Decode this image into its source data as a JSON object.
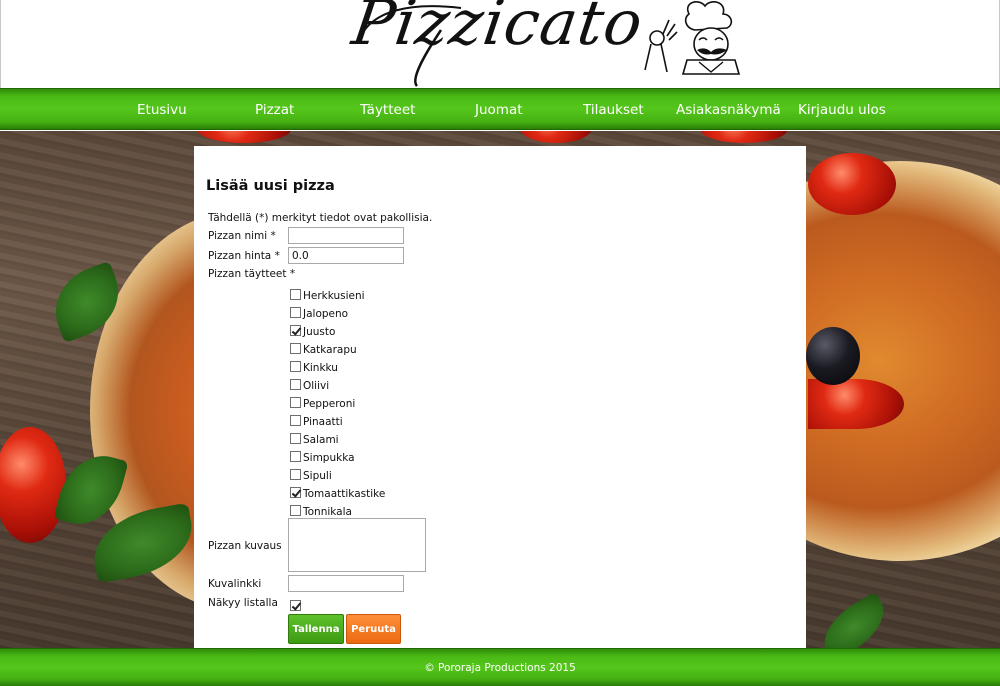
{
  "header": {
    "logo_text": "Pizzicato"
  },
  "nav": {
    "items": [
      "Etusivu",
      "Pizzat",
      "Täytteet",
      "Juomat",
      "Tilaukset",
      "Asiakasnäkymä",
      "Kirjaudu ulos"
    ]
  },
  "form": {
    "title": "Lisää uusi pizza",
    "required_note": "Tähdellä (*) merkityt tiedot ovat pakollisia.",
    "name_label": "Pizzan nimi *",
    "name_value": "",
    "price_label": "Pizzan hinta *",
    "price_value": "0.0",
    "toppings_label": "Pizzan täytteet *",
    "toppings": [
      {
        "label": "Herkkusieni",
        "checked": false
      },
      {
        "label": "Jalopeno",
        "checked": false
      },
      {
        "label": "Juusto",
        "checked": true
      },
      {
        "label": "Katkarapu",
        "checked": false
      },
      {
        "label": "Kinkku",
        "checked": false
      },
      {
        "label": "Oliivi",
        "checked": false
      },
      {
        "label": "Pepperoni",
        "checked": false
      },
      {
        "label": "Pinaatti",
        "checked": false
      },
      {
        "label": "Salami",
        "checked": false
      },
      {
        "label": "Simpukka",
        "checked": false
      },
      {
        "label": "Sipuli",
        "checked": false
      },
      {
        "label": "Tomaattikastike",
        "checked": true
      },
      {
        "label": "Tonnikala",
        "checked": false
      }
    ],
    "description_label": "Pizzan kuvaus",
    "description_value": "",
    "image_link_label": "Kuvalinkki",
    "image_link_value": "",
    "visible_label": "Näkyy listalla",
    "visible_checked": true,
    "save_label": "Tallenna",
    "cancel_label": "Peruuta"
  },
  "footer": {
    "text": "© Pororaja Productions 2015"
  },
  "colors": {
    "nav_green": "#4ab915",
    "save_green": "#4aa81a",
    "cancel_orange": "#f07a1e"
  }
}
